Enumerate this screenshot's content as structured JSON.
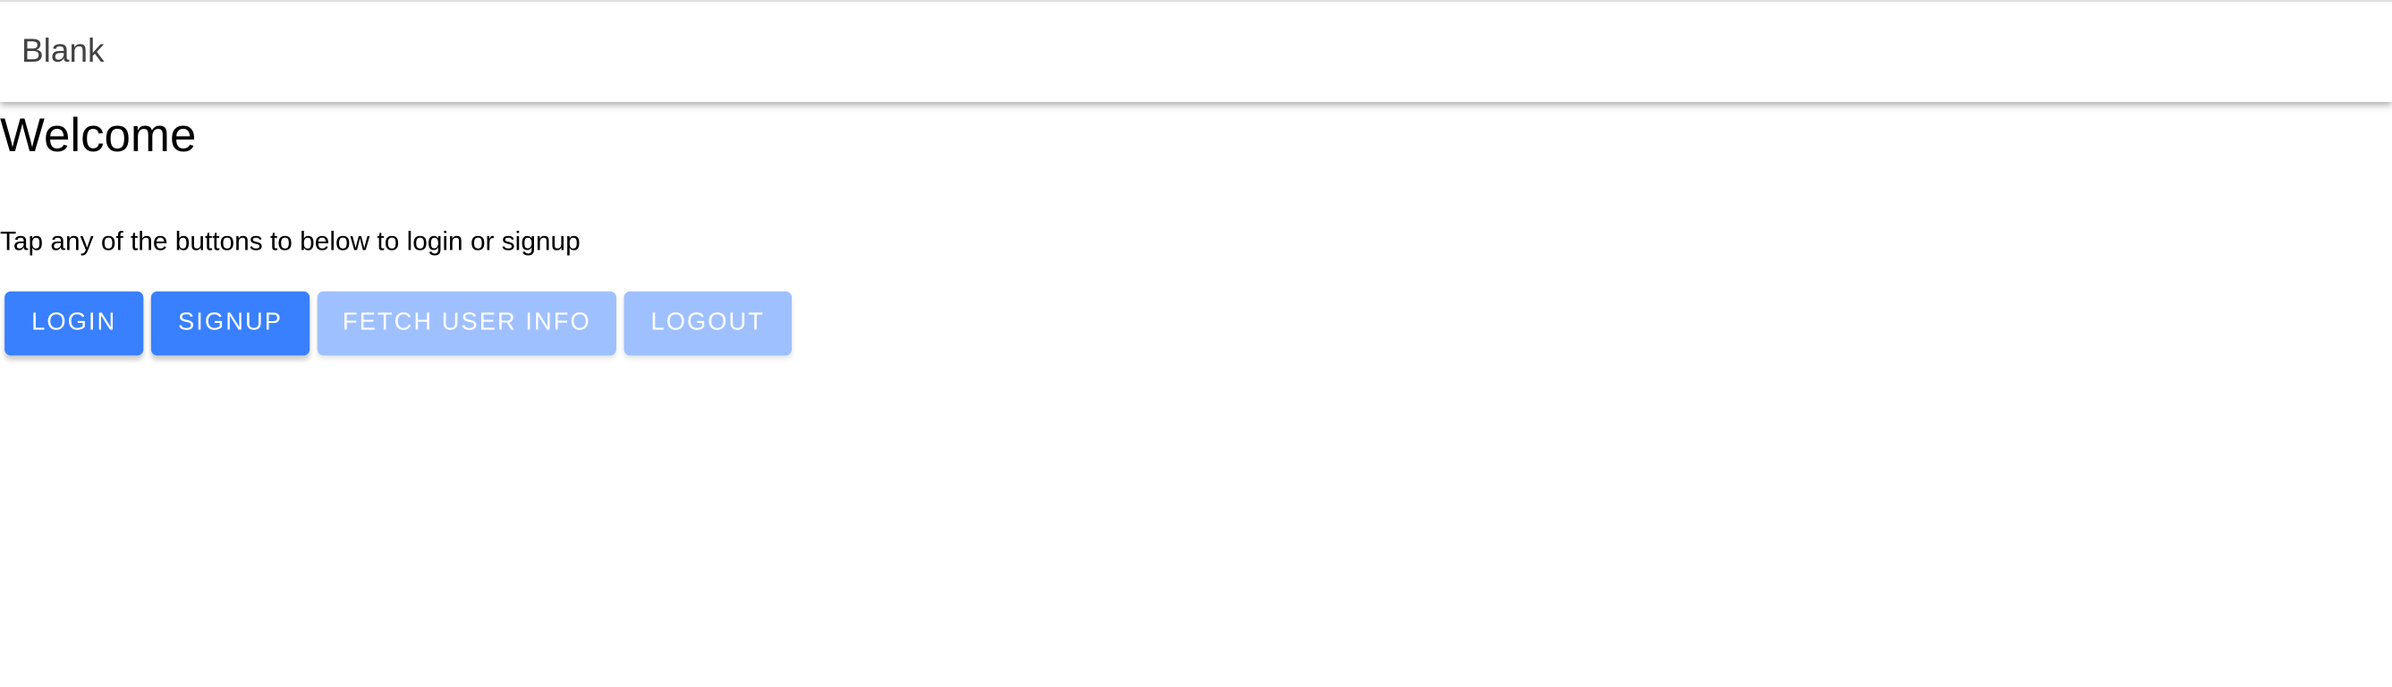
{
  "header": {
    "title": "Blank"
  },
  "main": {
    "heading": "Welcome",
    "description": "Tap any of the buttons to below to login or signup",
    "buttons": {
      "login": "LOGIN",
      "signup": "SIGNUP",
      "fetch_user_info": "FETCH USER INFO",
      "logout": "LOGOUT"
    }
  },
  "colors": {
    "primary": "#3880ff",
    "disabled": "#9fc0ff"
  }
}
